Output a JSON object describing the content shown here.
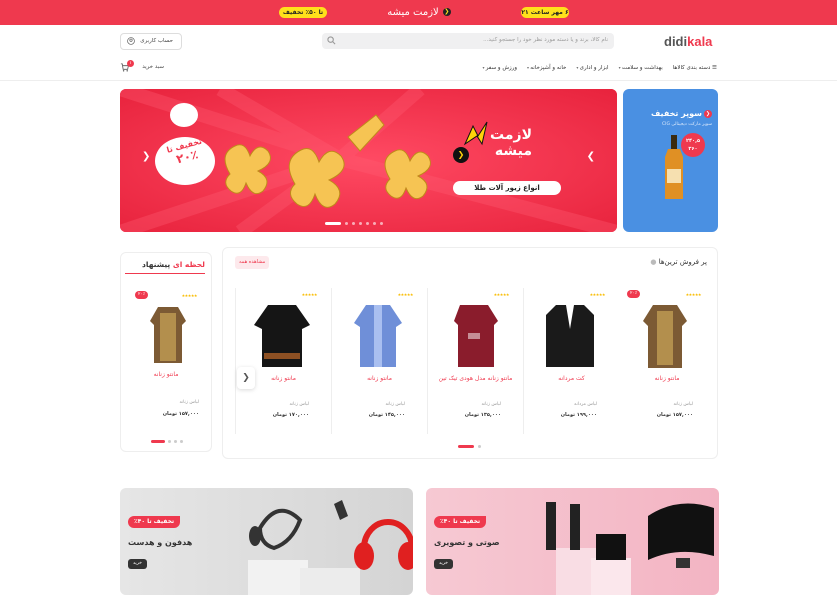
{
  "topbar": {
    "date_pill": "۶ مهر ساعت ۲۱",
    "center_text": "لازمت میشه",
    "discount_pill": "تا ۵۰٪ تخفیف"
  },
  "header": {
    "logo_dark": "didi",
    "logo_red": "kala",
    "search_placeholder": "نام کالا، برند و یا دسته مورد نظر خود را جستجو کنید...",
    "account_label": "حساب کاربری",
    "cart_label": "سبد خرید",
    "cart_count": "۱"
  },
  "nav": {
    "items": [
      "دسته بندی کالاها",
      "بهداشت و سلامت",
      "ابزار و اداری",
      "خانه و آشپزخانه",
      "ورزش و سفر"
    ]
  },
  "hero": {
    "title_line1": "لازمت",
    "title_line2": "میشه",
    "subtitle": "انواع زیور آلات طلا",
    "discount_line1": "تخفیف تا",
    "discount_line2": "۲۰٪",
    "slide_count": 7,
    "active_slide": 7
  },
  "promo": {
    "title": "سوپر تخفیف",
    "subtitle": "سوپر مارکت دیجیتالی CIG",
    "price_line1": "۲۴۰,۵",
    "price_line2": "۳۶۰",
    "price_line3": "۳۳۵"
  },
  "offer": {
    "title_red": "لحظه ای",
    "title_dark": "پیشنهاد",
    "product": {
      "discount": "۲۰٪",
      "stars": "★★★★★",
      "name": "مانتو زنانه",
      "category": "لباس زنانه",
      "price": "۱۵۷,۰۰۰ تومان"
    }
  },
  "best": {
    "title": "پر فروش ترین‌ها",
    "see_all": "مشاهده همه",
    "products": [
      {
        "name": "مانتو زنانه",
        "category": "لباس زنانه",
        "price": "۱۵۷,۰۰۰ تومان",
        "stars": "★★★★★",
        "discount": "۲۰٪"
      },
      {
        "name": "کت مردانه",
        "category": "لباس مردانه",
        "price": "۱۹۹,۰۰۰ تومان",
        "stars": "★★★★★",
        "discount": ""
      },
      {
        "name": "مانتو زنانه مدل هودی تیک تین",
        "category": "لباس زنانه",
        "price": "۱۳۵,۰۰۰ تومان",
        "stars": "★★★★★",
        "discount": ""
      },
      {
        "name": "مانتو زنانه",
        "category": "لباس زنانه",
        "price": "۱۴۵,۰۰۰ تومان",
        "stars": "★★★★★",
        "discount": ""
      },
      {
        "name": "مانتو زنانه",
        "category": "لباس زنانه",
        "price": "۱۷۰,۰۰۰ تومان",
        "stars": "★★★★★",
        "discount": ""
      }
    ]
  },
  "banners": [
    {
      "tag": "تخفیف تا ۴۰٪",
      "title": "صوتی و تصویری",
      "buy": "خرید"
    },
    {
      "tag": "تخفیف تا ۴۰٪",
      "title": "هدفون و هدست",
      "buy": "خرید"
    }
  ],
  "colors": {
    "accent": "#ef394e",
    "yellow": "#ffe01b",
    "promo_blue": "#4a90e2"
  }
}
